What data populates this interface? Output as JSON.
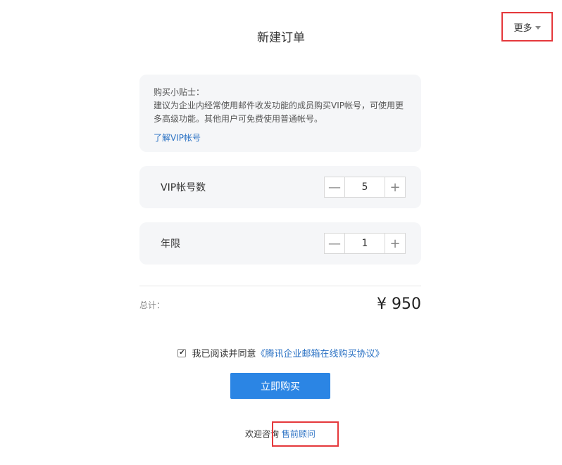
{
  "header": {
    "title": "新建订单",
    "more_label": "更多"
  },
  "tips": {
    "title": "购买小贴士：",
    "body": "建议为企业内经常使用邮件收发功能的成员购买VIP帐号，可使用更多高级功能。其他用户可免费使用普通帐号。",
    "link": "了解VIP帐号"
  },
  "order": {
    "vip_label": "VIP帐号数",
    "vip_count": "5",
    "years_label": "年限",
    "years_value": "1",
    "minus_symbol": "—",
    "plus_symbol": "+"
  },
  "total": {
    "label": "总计：",
    "value": "¥ 950"
  },
  "agreement": {
    "checked": true,
    "check_mark": "✔",
    "text": "我已阅读并同意",
    "link": "《腾讯企业邮箱在线购买协议》"
  },
  "buy_button": "立即购买",
  "consult": {
    "text": "欢迎咨询",
    "link": "售前顾问"
  },
  "colors": {
    "accent": "#2b85e4",
    "link": "#2b72c4",
    "highlight_box": "#e5383b",
    "card_bg": "#f5f6f8"
  }
}
